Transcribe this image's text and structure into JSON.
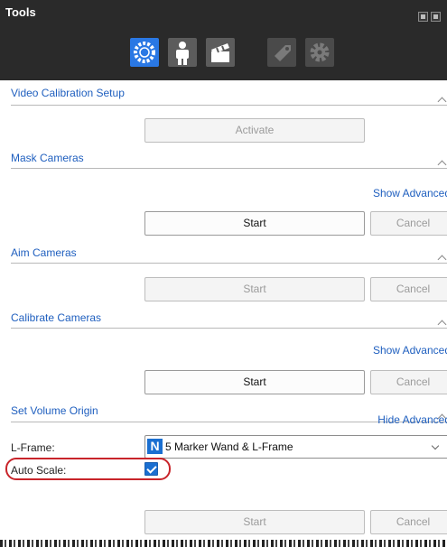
{
  "window": {
    "title": "Tools"
  },
  "toolbar": {
    "icons": [
      "calibration-icon",
      "skeleton-icon",
      "clapperboard-icon",
      "tag-icon",
      "gear-icon"
    ]
  },
  "sections": {
    "video": {
      "title": "Video Calibration Setup",
      "activate_label": "Activate"
    },
    "mask": {
      "title": "Mask Cameras",
      "advanced_label": "Show Advanced",
      "start_label": "Start",
      "cancel_label": "Cancel"
    },
    "aim": {
      "title": "Aim Cameras",
      "start_label": "Start",
      "cancel_label": "Cancel"
    },
    "calibrate": {
      "title": "Calibrate Cameras",
      "advanced_label": "Show Advanced",
      "start_label": "Start",
      "cancel_label": "Cancel"
    },
    "origin": {
      "title": "Set Volume Origin",
      "advanced_label": "Hide Advanced",
      "lframe_label": "L-Frame:",
      "lframe_value": "5 Marker Wand & L-Frame",
      "lframe_icon_letter": "N",
      "autoscale_label": "Auto Scale:",
      "autoscale_checked": true,
      "start_label": "Start",
      "cancel_label": "Cancel"
    }
  },
  "colors": {
    "accent": "#1f5fbf",
    "highlight": "#c8242a",
    "titlebar": "#2a2a2a"
  }
}
